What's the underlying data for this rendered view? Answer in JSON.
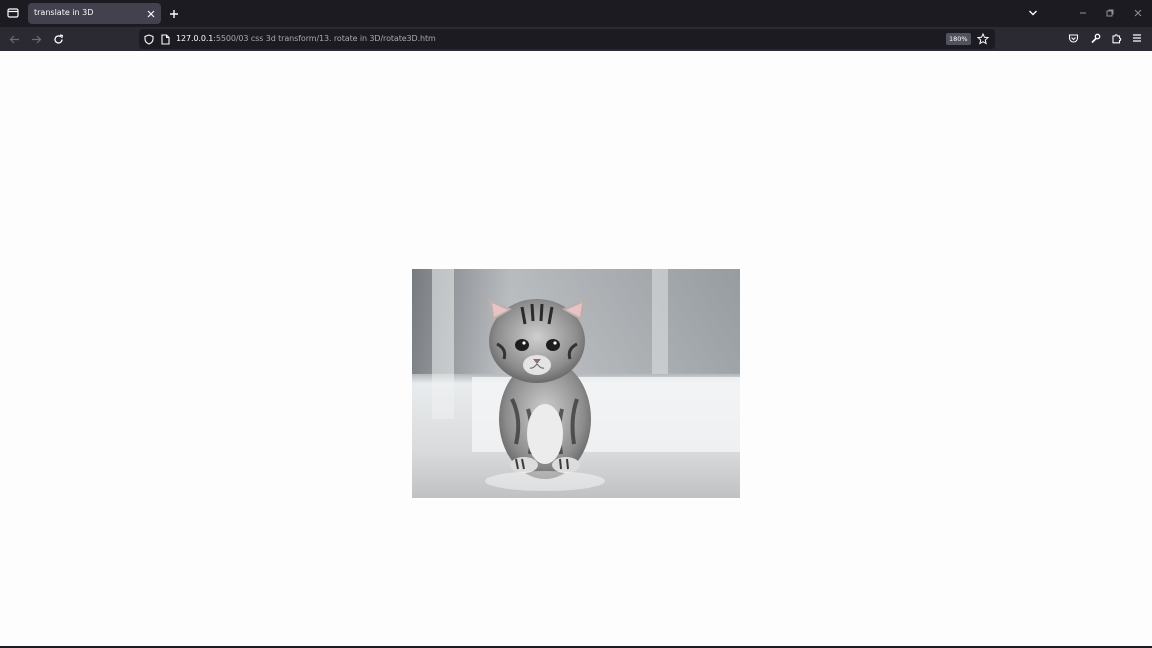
{
  "browser": {
    "tab": {
      "title": "translate in 3D"
    },
    "url": {
      "host": "127.0.0.1",
      "path": ":5500/03 css 3d transform/13. rotate in 3D/rotate3D.htm"
    },
    "zoom": "180%"
  },
  "icons": {
    "tabs_menu": "firefox-view-icon",
    "tab_close": "close-icon",
    "new_tab": "plus-icon",
    "list_all_tabs": "chevron-down-icon",
    "back": "arrow-left-icon",
    "forward": "arrow-right-icon",
    "reload": "reload-icon",
    "tracking_protection": "shield-icon",
    "page_info": "page-icon",
    "bookmark": "star-icon",
    "pocket": "pocket-icon",
    "devtools": "wrench-icon",
    "extensions": "puzzle-icon",
    "menu": "hamburger-icon"
  },
  "colors": {
    "chrome": "#1c1b22",
    "toolbar": "#2b2a33",
    "tab_active": "#42414d",
    "page_bg": "#fdfdfd"
  }
}
